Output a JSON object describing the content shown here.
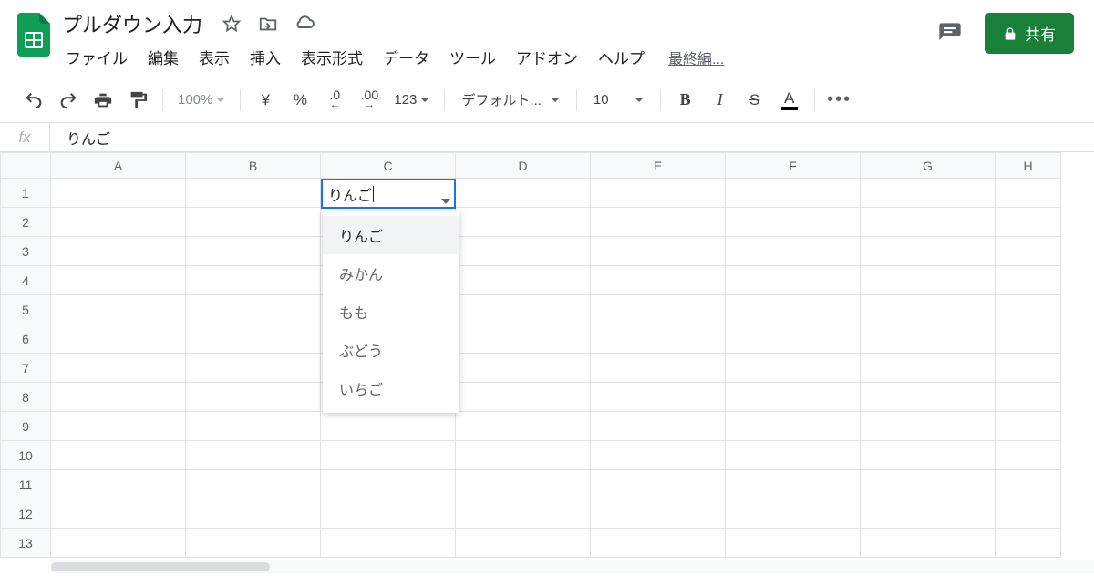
{
  "header": {
    "doc_title": "プルダウン入力",
    "last_edit": "最終編...",
    "share_label": "共有"
  },
  "menu": {
    "file": "ファイル",
    "edit": "編集",
    "view": "表示",
    "insert": "挿入",
    "format": "表示形式",
    "data": "データ",
    "tools": "ツール",
    "addons": "アドオン",
    "help": "ヘルプ"
  },
  "toolbar": {
    "zoom": "100%",
    "currency": "¥",
    "percent": "%",
    "dec_dec": ".0",
    "dec_inc": ".00",
    "more_formats": "123",
    "font": "デフォルト...",
    "font_size": "10",
    "bold": "B",
    "italic": "I",
    "strike": "S",
    "text_color": "A"
  },
  "formula_bar": {
    "fx": "fx",
    "value": "りんご"
  },
  "grid": {
    "columns": [
      "A",
      "B",
      "C",
      "D",
      "E",
      "F",
      "G",
      "H"
    ],
    "rows": [
      "1",
      "2",
      "3",
      "4",
      "5",
      "6",
      "7",
      "8",
      "9",
      "10",
      "11",
      "12",
      "13"
    ]
  },
  "active_cell": {
    "value": "りんご"
  },
  "dropdown": {
    "items": [
      "りんご",
      "みかん",
      "もも",
      "ぶどう",
      "いちご"
    ]
  }
}
